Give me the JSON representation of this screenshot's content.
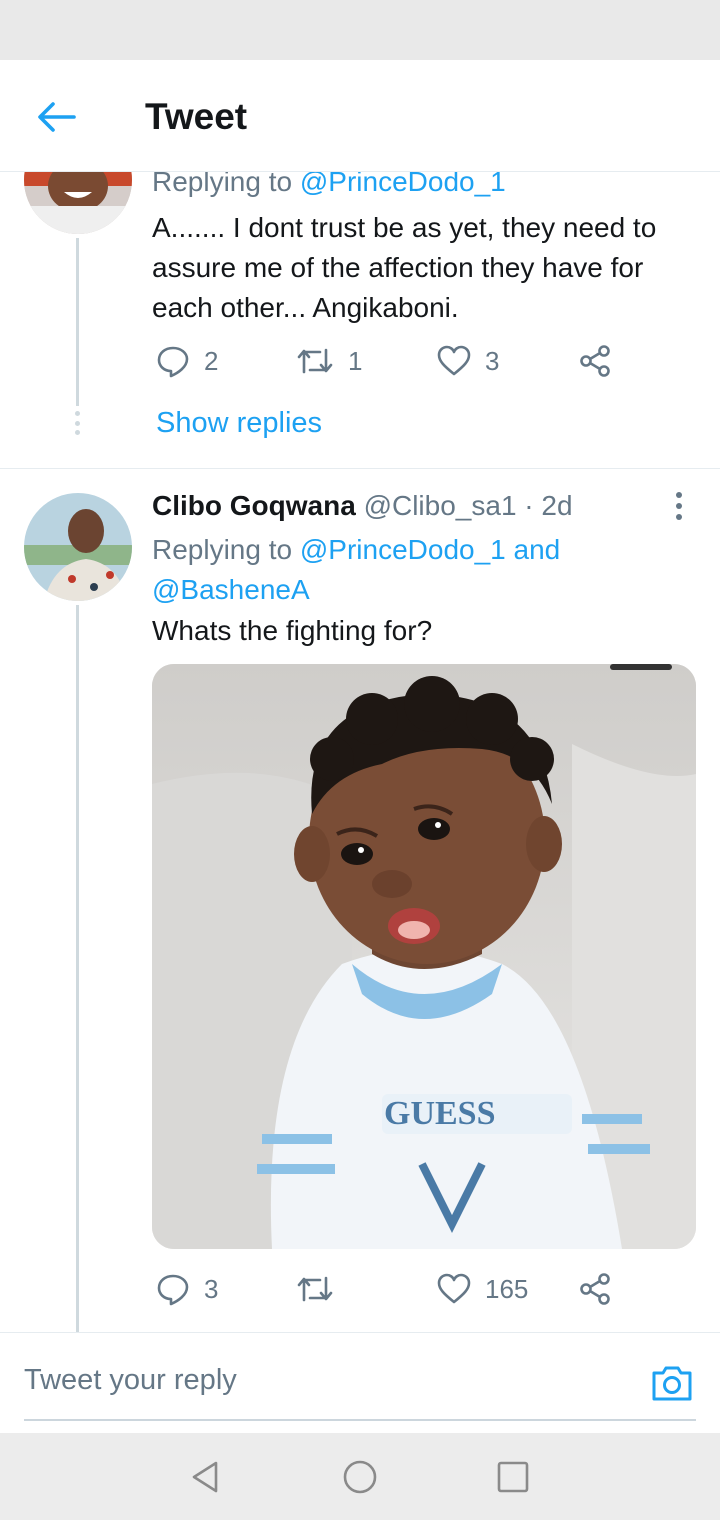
{
  "header": {
    "title": "Tweet",
    "back_icon": "arrow-left-icon"
  },
  "tweet1": {
    "replying_prefix": "Replying to ",
    "replying_mention": "@PrinceDodo_1",
    "text": "A....... I dont trust be as yet, they need to assure me of the affection they have for each other... Angikaboni.",
    "replies": "2",
    "retweets": "1",
    "likes": "3",
    "show_replies": "Show replies"
  },
  "tweet2": {
    "name": "Clibo Goqwana",
    "handle": "@Clibo_sa1",
    "sep": " · ",
    "time": "2d",
    "replying_prefix": "Replying to ",
    "replying_mention1": "@PrinceDodo_1",
    "replying_and": " and ",
    "replying_mention2": "@BasheneA",
    "text": "Whats the fighting for?",
    "media_shirt_logo": "GUESS",
    "replies": "3",
    "retweets": "",
    "likes": "165"
  },
  "reply_bar": {
    "placeholder": "Tweet your reply"
  },
  "colors": {
    "accent": "#1da1f2",
    "muted": "#657786",
    "text": "#14171a",
    "line": "#cfd9de"
  }
}
